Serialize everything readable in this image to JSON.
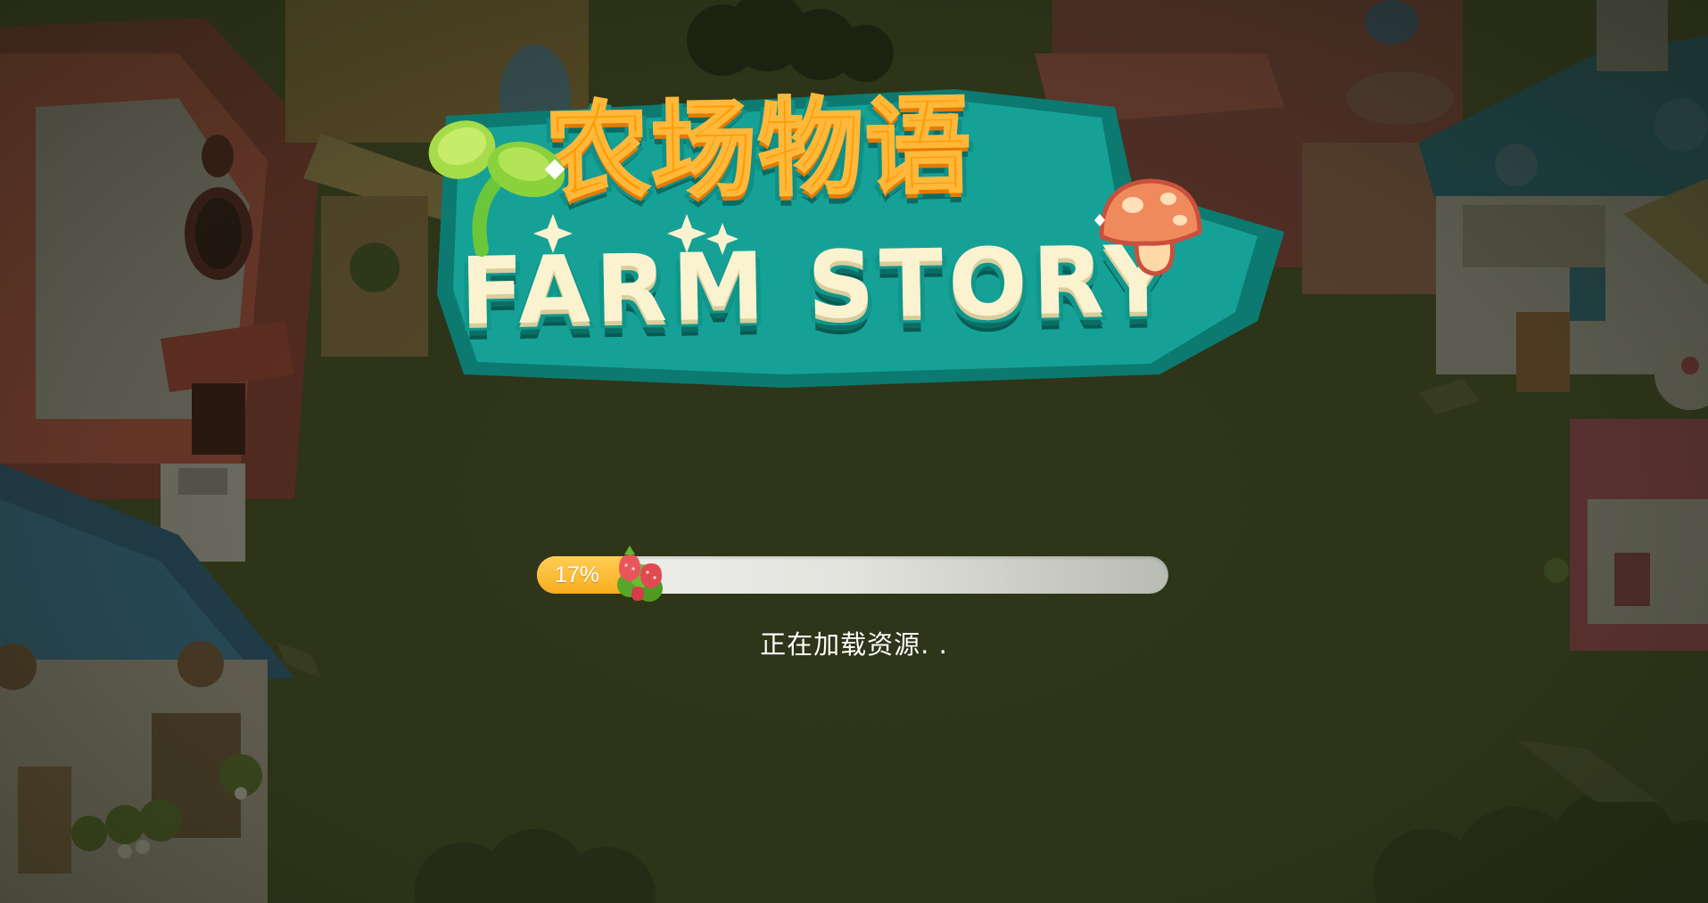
{
  "game": {
    "logo": {
      "title_cn": "农场物语",
      "title_en": "FARM STORY"
    },
    "loading": {
      "progress_percent": 17,
      "progress_label": "17%",
      "status_text": "正在加载资源. ."
    },
    "colors": {
      "background": "#2b3118",
      "logo_orange": "#ff9900",
      "logo_teal": "#11968b",
      "progress_fill": "#f9ad1e",
      "progress_track": "#e3e3de"
    },
    "icons": [
      "sprout-icon",
      "mushroom-icon",
      "strawberry-icon"
    ]
  }
}
